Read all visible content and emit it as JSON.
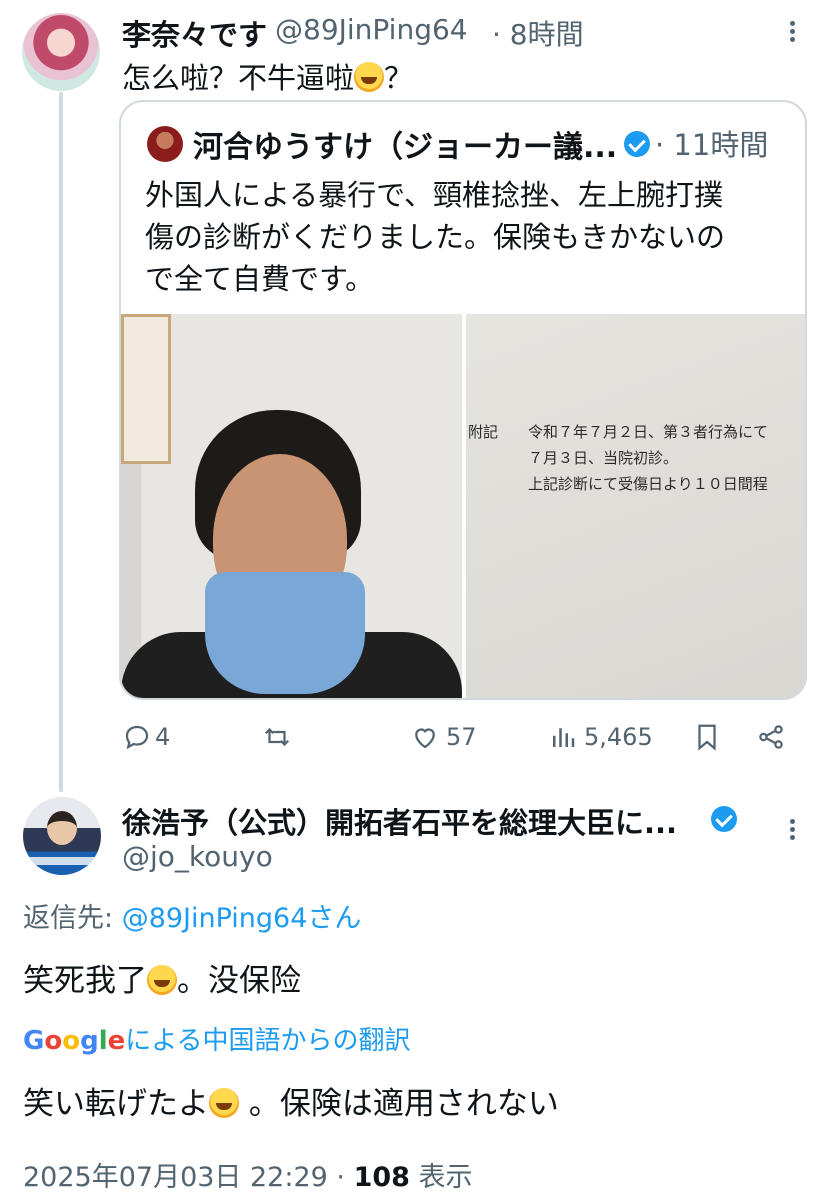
{
  "tweet1": {
    "name": "李奈々です",
    "handle": "@89JinPing64",
    "time": "· 8時間",
    "text_before": "怎么啦？不牛逼啦",
    "text_after": "？"
  },
  "quoted": {
    "name": "河合ゆうすけ（ジョーカー議...",
    "time": "· 11時間",
    "text": "外国人による暴行で、頸椎捻挫、左上腕打撲\n傷の診断がくだりました。保険もきかないの\nで全て自費です。",
    "doc_text": "附記　　令和７年７月２日、第３者行為にて\n　　　　７月３日、当院初診。\n　　　　上記診断にて受傷日より１０日間程"
  },
  "actions": {
    "reply_count": "4",
    "like_count": "57",
    "view_count": "5,465"
  },
  "tweet2": {
    "name": "徐浩予（公式）開拓者石平を総理大臣に...",
    "handle": "@jo_kouyo",
    "reply_label": "返信先: ",
    "reply_mention": "@89JinPing64さん",
    "text_before": "笑死我了",
    "text_after": "。没保险",
    "translate_brand": "Google",
    "translate_label": "による中国語からの翻訳",
    "translated_before": "笑い転げたよ",
    "translated_after": " 。保険は適用されない",
    "timestamp": "2025年07月03日 22:29 · ",
    "views": "108",
    "views_label": " 表示"
  },
  "colors": {
    "accent": "#1d9bf0",
    "secondary_text": "#536471",
    "border": "#cfd9de"
  }
}
